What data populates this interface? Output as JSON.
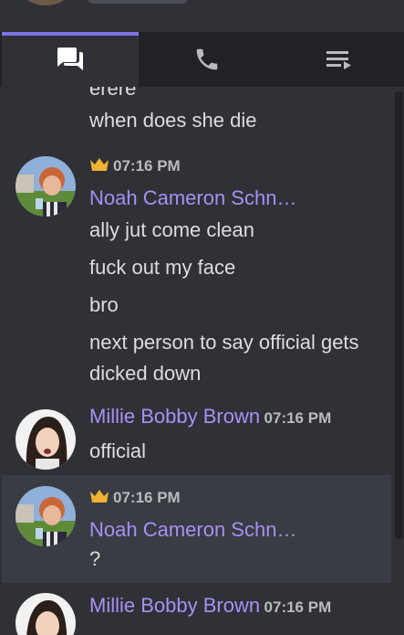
{
  "tabs": [
    {
      "label": "",
      "icon": "chat-icon",
      "active": true
    },
    {
      "label": "",
      "icon": "phone-icon",
      "active": false
    },
    {
      "label": "",
      "icon": "queue-icon",
      "active": false
    }
  ],
  "colors": {
    "accent": "#7c73e6",
    "username": "#a98ff5",
    "crown": "#f0b232",
    "background": "#2f3136",
    "tabbar": "#202225"
  },
  "messages": {
    "cut_line": "erere",
    "prev_line": "when does she die",
    "group1": {
      "time": "07:16 PM",
      "author": "Noah Cameron Schn…",
      "lines": [
        "ally jut come clean",
        "fuck out my face",
        "bro",
        "next person to say official gets dicked down"
      ]
    },
    "group2": {
      "time": "07:16 PM",
      "author": "Millie Bobby Brown",
      "lines": [
        "official"
      ]
    },
    "group3": {
      "time": "07:16 PM",
      "author": "Noah Cameron Schn…",
      "lines": [
        "?"
      ]
    },
    "group4": {
      "time": "07:16 PM",
      "author": "Millie Bobby Brown"
    }
  }
}
